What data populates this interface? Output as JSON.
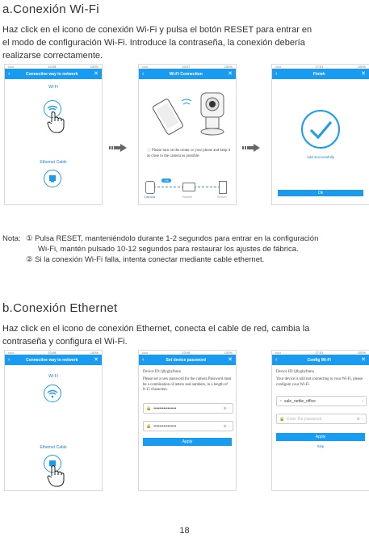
{
  "section_a": {
    "title": "a.Conexión Wi-Fi",
    "line1": "Haz click en el icono de conexión Wi-Fi y pulsa el botón RESET para entrar en",
    "line2": "el modo de configuración Wi-Fi. Introduce la contraseña, la conexión debería",
    "line3": "realizarse correctamente."
  },
  "phone_a1": {
    "status_left": "••••• ",
    "status_time": "10:08",
    "status_right": "100%",
    "nav_title": "Connective way to network",
    "wifi_label": "Wi-Fi",
    "ethernet_label": "Ethernet Cable"
  },
  "phone_a2": {
    "status_time": "10:07",
    "status_right": "100%",
    "nav_title": "Wi-Fi Connection",
    "hint": "Please turn on the router or your phone and keep it as close to the camera as possible.",
    "progress_badge": "1%",
    "camera_label": "Camera",
    "router_label": "Router",
    "server_label": "Server"
  },
  "phone_a3": {
    "status_time": "17:51",
    "status_right": "100%",
    "nav_title": "Finish",
    "success_text": "Add Successfully",
    "ok_button": "Ok"
  },
  "note": {
    "label": "Nota:",
    "item1a": "① Pulsa RESET, manteniéndolo durante 1-2 segundos para entrar en la configuración",
    "item1b": "Wi-Fi, mantén pulsado 10-12 segundos para restaurar los ajustes de fábrica.",
    "item2": "② Si la conexión Wi-Fi falla,  intenta conectar mediante cable ethernet."
  },
  "section_b": {
    "title": "b.Conexión Ethernet",
    "line1": "Haz click en el icono de conexión Ethernet,  conecta el cable de red, cambia la",
    "line2": "contraseña y  configura el Wi-Fi."
  },
  "phone_b1": {
    "status_time": "10:08",
    "status_right": "100%",
    "nav_title": "Connective way to network",
    "wifi_label": "Wi-Fi",
    "ethernet_label": "Ethernet Cable"
  },
  "phone_b2": {
    "status_time": "10:08",
    "status_right": "100%",
    "nav_title": "Set device password",
    "device_id": "Device ID:1j8ygbyfnma",
    "instructions": "Please set a new password for the camera.Password must be a combination of letters and numbers, in a length of 8-15 characters.",
    "field1": "••••••••••••••••",
    "field2": "••••••••••••••••",
    "apply_button": "Apply"
  },
  "phone_b3": {
    "status_time": "17:51",
    "status_right": "100%",
    "nav_title": "Config Wi-Fi",
    "device_id": "Device ID:1j8ygbyfnma",
    "instructions": "Your device is still not connecting to your Wi-Fi, please configure your Wi-Fi.",
    "ssid": "sale_nettie_office",
    "password_placeholder": "Enter the password",
    "apply_button": "Apply",
    "skip_link": "Skip"
  },
  "page_number": "18",
  "colors": {
    "accent": "#1a9bf2",
    "arrow": "#666666"
  }
}
